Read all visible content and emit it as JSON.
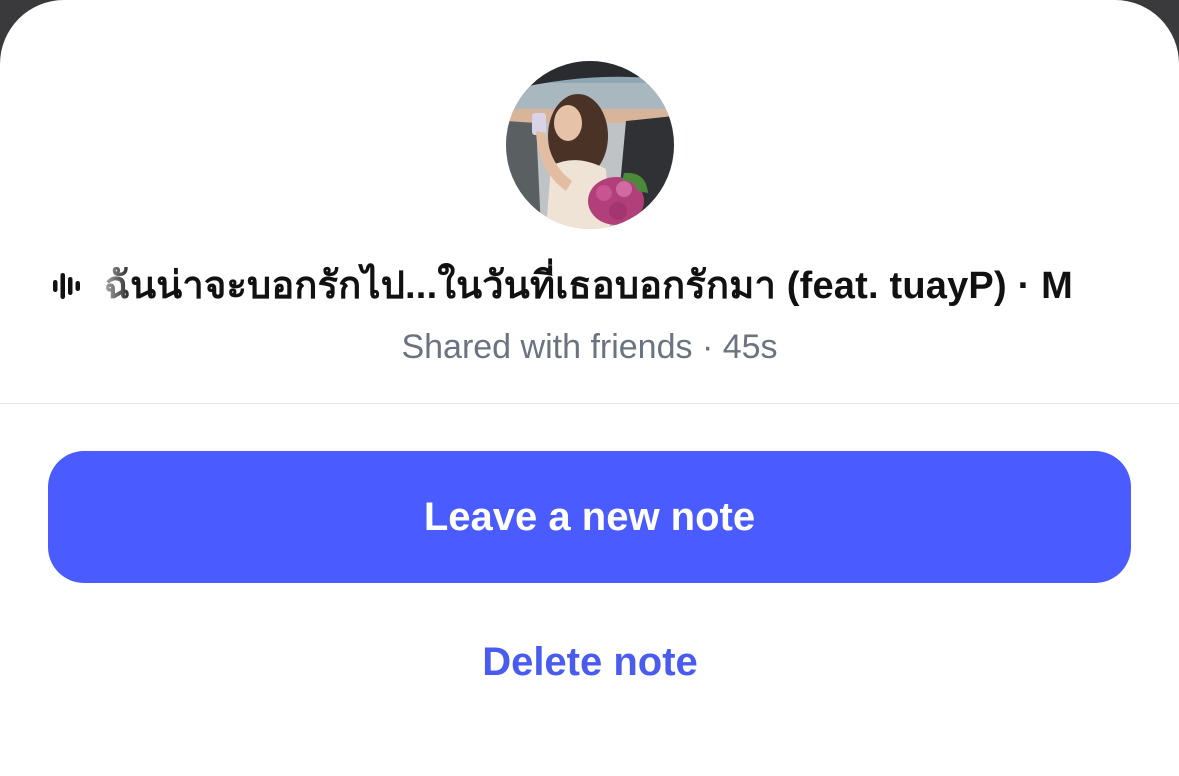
{
  "note": {
    "song_title": "ฉันน่าจะบอกรักไป...ในวันที่เธอบอกรักมา (feat. tuayP) · M",
    "audio_icon": "audio-wave-icon",
    "shared_status": "Shared with friends · 45s",
    "avatar_icon": "profile-photo"
  },
  "actions": {
    "primary_label": "Leave a new note",
    "secondary_label": "Delete note"
  },
  "colors": {
    "primary": "#4a5cff",
    "link": "#4a5cf0",
    "meta_text": "#6b7280"
  }
}
